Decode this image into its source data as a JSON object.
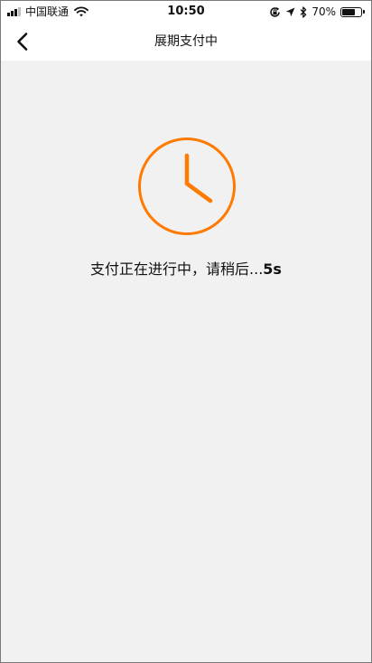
{
  "status_bar": {
    "carrier": "中国联通",
    "time": "10:50",
    "battery_percent": "70%",
    "battery_level": 0.7,
    "icons": [
      "signal-icon",
      "wifi-icon",
      "orientation-lock-icon",
      "location-arrow-icon",
      "bluetooth-icon",
      "battery-icon"
    ]
  },
  "nav": {
    "back_icon": "chevron-left-icon",
    "title": "展期支付中"
  },
  "main": {
    "icon": "clock-icon",
    "message": "支付正在进行中，请稍后...",
    "countdown": "5s"
  },
  "colors": {
    "accent": "#ff7a00",
    "background": "#f1f1f1",
    "bar": "#ffffff",
    "text": "#111111"
  }
}
